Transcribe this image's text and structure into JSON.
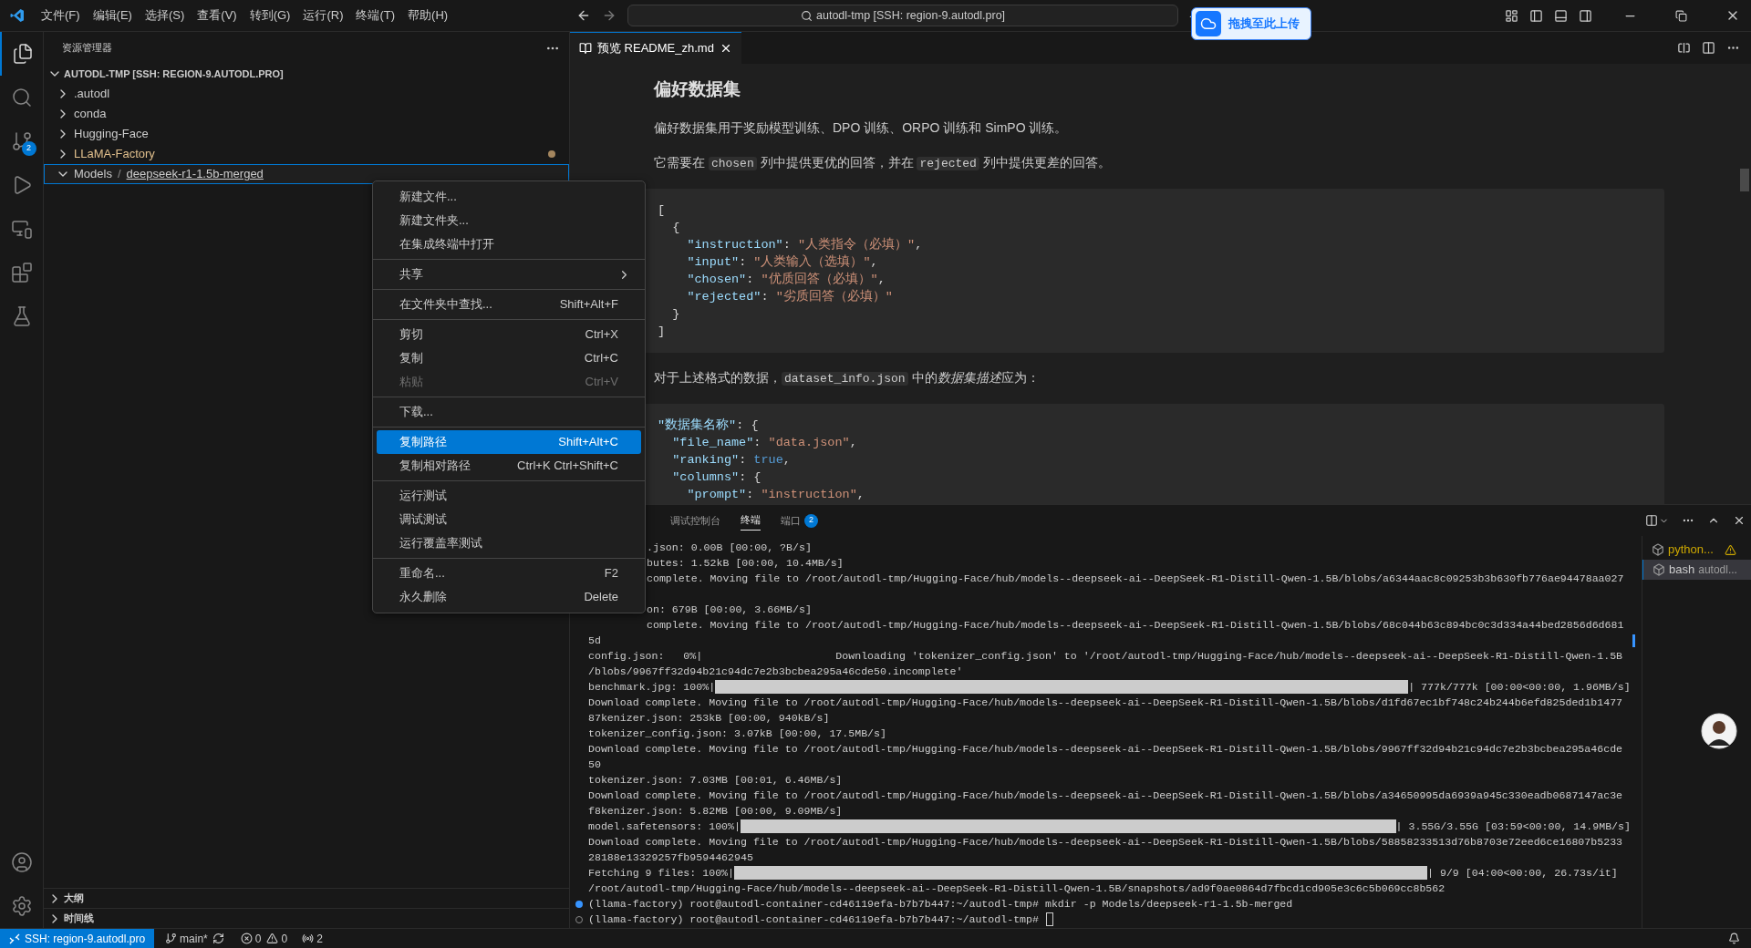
{
  "title_bar": {
    "menus": [
      "文件(F)",
      "编辑(E)",
      "选择(S)",
      "查看(V)",
      "转到(G)",
      "运行(R)",
      "终端(T)",
      "帮助(H)"
    ],
    "command_center": "autodl-tmp [SSH: region-9.autodl.pro]",
    "upload_button": "拖拽至此上传"
  },
  "activity_bar": {
    "items": [
      {
        "kind": "explorer",
        "selected": true
      },
      {
        "kind": "search",
        "selected": false
      },
      {
        "kind": "source-control",
        "selected": false,
        "badge": "2"
      },
      {
        "kind": "run",
        "selected": false
      },
      {
        "kind": "remote",
        "selected": false
      },
      {
        "kind": "extensions",
        "selected": false
      },
      {
        "kind": "testing",
        "selected": false
      }
    ],
    "bottom": [
      {
        "kind": "account"
      },
      {
        "kind": "settings"
      }
    ]
  },
  "explorer": {
    "title": "资源管理器",
    "root": "AUTODL-TMP [SSH: REGION-9.AUTODL.PRO]",
    "items": [
      {
        "name": ".autodl",
        "expanded": false,
        "selected": false,
        "modified": false
      },
      {
        "name": "conda",
        "expanded": false,
        "selected": false,
        "modified": false
      },
      {
        "name": "Hugging-Face",
        "expanded": false,
        "selected": false,
        "modified": false
      },
      {
        "name": "LLaMA-Factory",
        "expanded": false,
        "selected": false,
        "modified": true
      },
      {
        "name": "Models",
        "separator": "/",
        "sub": "deepseek-r1-1.5b-merged",
        "expanded": true,
        "selected": true,
        "modified": false
      }
    ],
    "sections": [
      {
        "label": "大纲",
        "expanded": false
      },
      {
        "label": "时间线",
        "expanded": false
      }
    ]
  },
  "context_menu": {
    "groups": [
      [
        {
          "label": "新建文件...",
          "kind": "command",
          "selected": false,
          "disabled": false
        },
        {
          "label": "新建文件夹...",
          "kind": "command",
          "selected": false,
          "disabled": false
        },
        {
          "label": "在集成终端中打开",
          "kind": "command",
          "selected": false,
          "disabled": false
        }
      ],
      [
        {
          "label": "共享",
          "kind": "submenu",
          "selected": false,
          "disabled": false
        }
      ],
      [
        {
          "label": "在文件夹中查找...",
          "shortcut": "Shift+Alt+F",
          "kind": "command",
          "selected": false,
          "disabled": false
        }
      ],
      [
        {
          "label": "剪切",
          "shortcut": "Ctrl+X",
          "kind": "command",
          "selected": false,
          "disabled": false
        },
        {
          "label": "复制",
          "shortcut": "Ctrl+C",
          "kind": "command",
          "selected": false,
          "disabled": false
        },
        {
          "label": "粘贴",
          "shortcut": "Ctrl+V",
          "kind": "command",
          "selected": false,
          "disabled": true
        }
      ],
      [
        {
          "label": "下载...",
          "kind": "command",
          "selected": false,
          "disabled": false
        }
      ],
      [
        {
          "label": "复制路径",
          "shortcut": "Shift+Alt+C",
          "kind": "command",
          "selected": true,
          "disabled": false
        },
        {
          "label": "复制相对路径",
          "shortcut": "Ctrl+K Ctrl+Shift+C",
          "kind": "command",
          "selected": false,
          "disabled": false
        }
      ],
      [
        {
          "label": "运行测试",
          "kind": "command",
          "selected": false,
          "disabled": false
        },
        {
          "label": "调试测试",
          "kind": "command",
          "selected": false,
          "disabled": false
        },
        {
          "label": "运行覆盖率测试",
          "kind": "command",
          "selected": false,
          "disabled": false
        }
      ],
      [
        {
          "label": "重命名...",
          "shortcut": "F2",
          "kind": "command",
          "selected": false,
          "disabled": false
        },
        {
          "label": "永久删除",
          "shortcut": "Delete",
          "kind": "command",
          "selected": false,
          "disabled": false
        }
      ]
    ]
  },
  "editor": {
    "tab": {
      "label": "预览 README_zh.md",
      "selected": true
    },
    "content": [
      {
        "kind": "heading",
        "segments": [
          {
            "kind": "text",
            "s": "偏好数据集"
          }
        ]
      },
      {
        "kind": "paragraph",
        "segments": [
          {
            "kind": "text",
            "s": "偏好数据集用于奖励模型训练、DPO 训练、ORPO 训练和 SimPO 训练。"
          }
        ]
      },
      {
        "kind": "paragraph",
        "segments": [
          {
            "kind": "text",
            "s": "它需要在 "
          },
          {
            "kind": "code",
            "s": "chosen"
          },
          {
            "kind": "text",
            "s": " 列中提供更优的回答，并在 "
          },
          {
            "kind": "code",
            "s": "rejected"
          },
          {
            "kind": "text",
            "s": " 列中提供更差的回答。"
          }
        ]
      },
      {
        "kind": "codeblock",
        "lines": [
          [
            {
              "kind": "punct",
              "s": "["
            }
          ],
          [
            {
              "kind": "punct",
              "s": "  {"
            }
          ],
          [
            {
              "kind": "key",
              "s": "    \"instruction\""
            },
            {
              "kind": "punct",
              "s": ": "
            },
            {
              "kind": "string",
              "s": "\"人类指令（必填）\""
            },
            {
              "kind": "punct",
              "s": ","
            }
          ],
          [
            {
              "kind": "key",
              "s": "    \"input\""
            },
            {
              "kind": "punct",
              "s": ": "
            },
            {
              "kind": "string",
              "s": "\"人类输入（选填）\""
            },
            {
              "kind": "punct",
              "s": ","
            }
          ],
          [
            {
              "kind": "key",
              "s": "    \"chosen\""
            },
            {
              "kind": "punct",
              "s": ": "
            },
            {
              "kind": "string",
              "s": "\"优质回答（必填）\""
            },
            {
              "kind": "punct",
              "s": ","
            }
          ],
          [
            {
              "kind": "key",
              "s": "    \"rejected\""
            },
            {
              "kind": "punct",
              "s": ": "
            },
            {
              "kind": "string",
              "s": "\"劣质回答（必填）\""
            }
          ],
          [
            {
              "kind": "punct",
              "s": "  }"
            }
          ],
          [
            {
              "kind": "punct",
              "s": "]"
            }
          ]
        ]
      },
      {
        "kind": "paragraph",
        "segments": [
          {
            "kind": "text",
            "s": "对于上述格式的数据，"
          },
          {
            "kind": "code",
            "s": "dataset_info.json"
          },
          {
            "kind": "text",
            "s": " 中的"
          },
          {
            "kind": "em",
            "s": "数据集描述"
          },
          {
            "kind": "text",
            "s": "应为："
          }
        ]
      },
      {
        "kind": "codeblock",
        "lines": [
          [
            {
              "kind": "key",
              "s": "\"数据集名称\""
            },
            {
              "kind": "punct",
              "s": ": {"
            }
          ],
          [
            {
              "kind": "key",
              "s": "  \"file_name\""
            },
            {
              "kind": "punct",
              "s": ": "
            },
            {
              "kind": "string",
              "s": "\"data.json\""
            },
            {
              "kind": "punct",
              "s": ","
            }
          ],
          [
            {
              "kind": "key",
              "s": "  \"ranking\""
            },
            {
              "kind": "punct",
              "s": ": "
            },
            {
              "kind": "bool",
              "s": "true"
            },
            {
              "kind": "punct",
              "s": ","
            }
          ],
          [
            {
              "kind": "key",
              "s": "  \"columns\""
            },
            {
              "kind": "punct",
              "s": ": {"
            }
          ],
          [
            {
              "kind": "key",
              "s": "    \"prompt\""
            },
            {
              "kind": "punct",
              "s": ": "
            },
            {
              "kind": "string",
              "s": "\"instruction\""
            },
            {
              "kind": "punct",
              "s": ","
            }
          ]
        ]
      }
    ]
  },
  "panel": {
    "tabs": [
      {
        "label": "调试控制台",
        "selected": false
      },
      {
        "label": "终端",
        "selected": true
      },
      {
        "label": "端口",
        "badge": "2",
        "selected": false
      }
    ],
    "terminal_lines": [
      {
        "kind": "partial",
        "s": ".json: 0.00B [00:00, ?B/s]"
      },
      {
        "kind": "partial",
        "s": "butes: 1.52kB [00:00, 10.4MB/s]"
      },
      {
        "kind": "partial",
        "s": "complete. Moving file to /root/autodl-tmp/Hugging-Face/hub/models--deepseek-ai--DeepSeek-R1-Distill-Qwen-1.5B/blobs/a6344aac8c09253b3b630fb776ae94478aa027"
      },
      {
        "kind": "blank"
      },
      {
        "kind": "partial",
        "s": "on: 679B [00:00, 3.66MB/s]"
      },
      {
        "kind": "partial",
        "s": "complete. Moving file to /root/autodl-tmp/Hugging-Face/hub/models--deepseek-ai--DeepSeek-R1-Distill-Qwen-1.5B/blobs/68c044b63c894bc0c3d334a44bed2856d6d681"
      },
      {
        "kind": "text",
        "s": "5d"
      },
      {
        "kind": "text",
        "s": "config.json:   0%|                     Downloading 'tokenizer_config.json' to '/root/autodl-tmp/Hugging-Face/hub/models--deepseek-ai--DeepSeek-R1-Distill-Qwen-1.5B"
      },
      {
        "kind": "text",
        "s": "/blobs/9967ff32d94b21c94dc7e2b3bcbea295a46cde50.incomplete'"
      },
      {
        "kind": "progress",
        "s": "benchmark.jpg: 100%|",
        "level": 1,
        "suffix": "| 777k/777k [00:00<00:00, 1.96MB/s]"
      },
      {
        "kind": "text",
        "s": "Download complete. Moving file to /root/autodl-tmp/Hugging-Face/hub/models--deepseek-ai--DeepSeek-R1-Distill-Qwen-1.5B/blobs/d1fd67ec1bf748c24b244b6efd825ded1b1477"
      },
      {
        "kind": "text",
        "s": "87kenizer.json: 253kB [00:00, 940kB/s]"
      },
      {
        "kind": "text",
        "s": "tokenizer_config.json: 3.07kB [00:00, 17.5MB/s]"
      },
      {
        "kind": "text",
        "s": "Download complete. Moving file to /root/autodl-tmp/Hugging-Face/hub/models--deepseek-ai--DeepSeek-R1-Distill-Qwen-1.5B/blobs/9967ff32d94b21c94dc7e2b3bcbea295a46cde"
      },
      {
        "kind": "text",
        "s": "50"
      },
      {
        "kind": "text",
        "s": "tokenizer.json: 7.03MB [00:01, 6.46MB/s]"
      },
      {
        "kind": "text",
        "s": "Download complete. Moving file to /root/autodl-tmp/Hugging-Face/hub/models--deepseek-ai--DeepSeek-R1-Distill-Qwen-1.5B/blobs/a34650995da6939a945c330eadb0687147ac3e"
      },
      {
        "kind": "text",
        "s": "f8kenizer.json: 5.82MB [00:00, 9.09MB/s]"
      },
      {
        "kind": "progress",
        "s": "model.safetensors: 100%|",
        "level": 1,
        "suffix": "| 3.55G/3.55G [03:59<00:00, 14.9MB/s]"
      },
      {
        "kind": "text",
        "s": "Download complete. Moving file to /root/autodl-tmp/Hugging-Face/hub/models--deepseek-ai--DeepSeek-R1-Distill-Qwen-1.5B/blobs/58858233513d76b8703e72eed6ce16807b5233"
      },
      {
        "kind": "text",
        "s": "28188e13329257fb9594462945"
      },
      {
        "kind": "progress",
        "s": "Fetching 9 files: 100%|",
        "level": 1,
        "suffix": "| 9/9 [04:00<00:00, 26.73s/it]"
      },
      {
        "kind": "text",
        "s": "/root/autodl-tmp/Hugging-Face/hub/models--deepseek-ai--DeepSeek-R1-Distill-Qwen-1.5B/snapshots/ad9f0ae0864d7fbcd1cd905e3c6c5b069cc8b562"
      },
      {
        "kind": "prompt",
        "s": "(llama-factory) root@autodl-container-cd46119efa-b7b7b447:~/autodl-tmp# mkdir -p Models/deepseek-r1-1.5b-merged",
        "done": true,
        "cursor": false
      },
      {
        "kind": "prompt",
        "s": "(llama-factory) root@autodl-container-cd46119efa-b7b7b447:~/autodl-tmp#",
        "done": false,
        "cursor": true
      }
    ],
    "terminals": [
      {
        "name": "python...",
        "warning": true,
        "selected": false
      },
      {
        "name": "bash",
        "detail": "autodl...",
        "warning": false,
        "selected": true
      }
    ]
  },
  "status_bar": {
    "remote": "SSH: region-9.autodl.pro",
    "branch": "main*",
    "errors": "0",
    "warnings": "0",
    "ports": "2"
  }
}
